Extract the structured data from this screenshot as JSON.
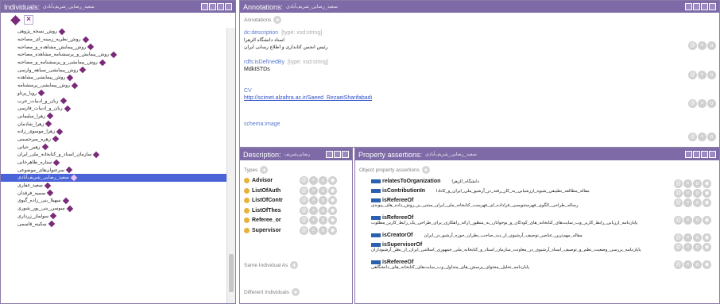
{
  "colors": {
    "title_bar": "#7d6aa6",
    "selection": "#4a63d6",
    "individual_icon": "#7a2a78",
    "type_dot": "#e8b33c",
    "property_icon": "#2b5fb0",
    "link": "#2f51c8"
  },
  "individuals": {
    "title": "Individuals:",
    "title_sub": "سعید_رضایی_شریف‌آبادی",
    "items": [
      "روش_نسخه_پژوهی",
      "روش_نظریه_زمینه_ای_مصاحبه",
      "روش_پیمایش_مشاهده_و_مصاحبه",
      "روش_پیمایش_و_پرسشنامه_مشاهده_مصاحبه",
      "روش_پیمایشی_و_پرسشنامه_و_مصاحبه",
      "روش_پیمایشی_سیاهه_وارسی",
      "روش_پیمایشی_مشاهده",
      "روش_پیمایشی_پرسشنامه",
      "رویا_پرتاو",
      "زبان_و_ادبیات_عرب",
      "زبان_و_ادبیات_فارسی",
      "زهرا_سلیمانی",
      "زهرا_شادمان",
      "زهرا_موسوی_زاده",
      "زهره_میرحسینی",
      "زهیر_حیاتی",
      "سازمان_اسناد_و_کتابخانه_ملی_ایران",
      "ستاره_طاهرخانی",
      "سرعنوان‌های_موضوعی",
      "سعید_رضایی_شریف‌آبادی",
      "سعید_غفاری",
      "سمیه_فرقدان",
      "سهیلا_بنی_زاده_گیوی",
      "سوسن_بنی_پور_شوری",
      "سولماز_زرداری",
      "سکینه_قاسمی"
    ],
    "selected_index": 19
  },
  "annotations": {
    "title": "Annotations:",
    "title_sub": "سعید_رضایی_شریف‌آبادی",
    "section_label": "Annotations",
    "items": [
      {
        "property": "dc:description",
        "type": "[type: xsd:string]",
        "value_lines": [
          "استاد دانشگاه الزهرا",
          "رئیس انجمن کتابداری و اطلاع رسانی ایران"
        ]
      },
      {
        "property": "rdfs:isDefinedBy",
        "type": "[type: xsd:string]",
        "value_lines": [
          "MdkISTDs"
        ]
      },
      {
        "property": "CV",
        "type": "",
        "value_lines": [
          "http://scimet.alzahra.ac.ir/Saeed_RezaeiSharifabadi"
        ]
      },
      {
        "property": "schema:image",
        "type": "",
        "value_lines": []
      }
    ]
  },
  "description": {
    "title": "Description:",
    "title_sub": "رضایی‌شریف",
    "types_label": "Types",
    "types": [
      "Advisor",
      "ListOfAuth",
      "ListOfContr",
      "ListOfThes",
      "Referee_or",
      "Supervisor"
    ],
    "same_individual_label": "Same Individual As",
    "different_individuals_label": "Different Individuals"
  },
  "properties": {
    "title": "Property assertions:",
    "title_sub": "سعید_رضایی_شریف‌آبادی",
    "section_label": "Object property assertions",
    "items": [
      {
        "name": "relatesToOrganization",
        "value": "دانشگاه_الزهرا",
        "inline": true
      },
      {
        "name": "isContributionIn",
        "value": "مقاله_مطالعه_تطبیقی_شیوه_ارزشیابی_به_کار_رفته_در_آرشیو_ملی_ایران_و_کانادا",
        "inline": true
      },
      {
        "name": "isRefereeOf",
        "value": "رساله_طراحی_الگوی_فهرستنویسی_فراداده_ای_فهرست_کتابخانه_ملی_ایران_مبتنی_بر_روش_داده_های_پیوندی",
        "inline": false
      },
      {
        "name": "isRefereeOf",
        "value": "پایان‌نامه_ارزیابی_رابط_کاربر_وب_سایت‌های_کتابخانه_های_کودکان_و_نوجوانان_به_منظور_ارائه_راهکاری_برای_طراحی_یک_رابط_کاربر_مطلوب",
        "inline": false
      },
      {
        "name": "isCreatorOf",
        "value": "مقاله_مهم‌ترین_عناصر_توصیف_آرشیوی_از_دید_صاحب_نظران_حوزه_آرشیو_در_ایران",
        "inline": true
      },
      {
        "name": "isSupervisorOf",
        "value": "پایان‌نامه_بررسی_وضعیت_نظم_و_توصیف_اسناد_آرشیوی_در_معاونت_سازمان_اسناد_و_کتابخانه_ملی_جمهوری_اسلامی_ایران_از_نظر_آرشیوداران",
        "inline": false
      },
      {
        "name": "isRefereeOf",
        "value": "پایان‌نامه_تحلیل_محتوای_پرسش_های_متداول_وب_سایت‌های_کتابخانه_های_دانشگاهی",
        "inline": false
      }
    ]
  },
  "watermark": "پژوهشگاه علوم انسانی و مطالعات فرهنگی"
}
